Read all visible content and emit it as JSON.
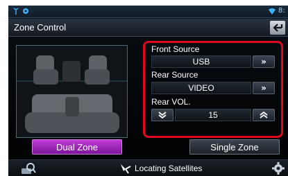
{
  "title": "Zone Control",
  "status": {
    "clock_partial": "8:"
  },
  "front_source": {
    "label": "Front Source",
    "value": "USB",
    "next_arrow": "»"
  },
  "rear_source": {
    "label": "Rear Source",
    "value": "VIDEO",
    "next_arrow": "»"
  },
  "rear_vol": {
    "label": "Rear VOL.",
    "value": "15"
  },
  "zone_buttons": {
    "dual": "Dual Zone",
    "single": "Single Zone",
    "selected": "dual"
  },
  "bottom": {
    "navigation_status": "Locating Satellites"
  },
  "icons": {
    "status_left": [
      "signal-icon",
      "bluetooth-icon"
    ],
    "status_right": [
      "wifi-icon"
    ],
    "back": "back-arrow-icon",
    "vol_down": "chevron-down-icon",
    "vol_up": "chevron-up-icon",
    "bottom_left": "search-media-icon",
    "bottom_center": "satellite-icon",
    "bottom_right": "gear-icon"
  },
  "colors": {
    "highlight": "#e0081e",
    "dual_zone_active": "#a42bbf",
    "accent_blue": "#3fb3ff"
  }
}
